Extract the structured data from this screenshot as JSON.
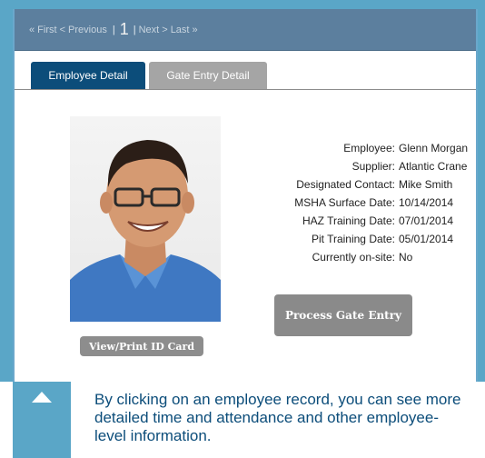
{
  "pager": {
    "first": "« First",
    "previous": "< Previous",
    "current_page": "1",
    "next": "Next >",
    "last": "Last »"
  },
  "tabs": [
    {
      "label": "Employee Detail",
      "active": true
    },
    {
      "label": "Gate Entry Detail",
      "active": false
    }
  ],
  "employee": {
    "fields": [
      {
        "label": "Employee:",
        "value": "Glenn Morgan"
      },
      {
        "label": "Supplier:",
        "value": "Atlantic Crane"
      },
      {
        "label": "Designated Contact:",
        "value": "Mike Smith"
      },
      {
        "label": "MSHA Surface Date:",
        "value": "10/14/2014"
      },
      {
        "label": "HAZ Training Date:",
        "value": "07/01/2014"
      },
      {
        "label": "Pit Training Date:",
        "value": "05/01/2014"
      },
      {
        "label": "Currently on-site:",
        "value": "No"
      }
    ],
    "id_card_button": "View/Print ID Card",
    "gate_entry_button": "Process Gate Entry"
  },
  "callout": {
    "icon": "triangle-up-icon",
    "text": "By clicking on an employee record, you can see more detailed time and attendance and other employee-level information."
  },
  "colors": {
    "frame": "#5aa6c7",
    "pager_bar": "#5c7f9e",
    "active_tab": "#0c4d7a",
    "inactive_tab": "#a5a5a5",
    "button_gray": "#8a8a8a",
    "callout_text": "#0c4d7a"
  }
}
